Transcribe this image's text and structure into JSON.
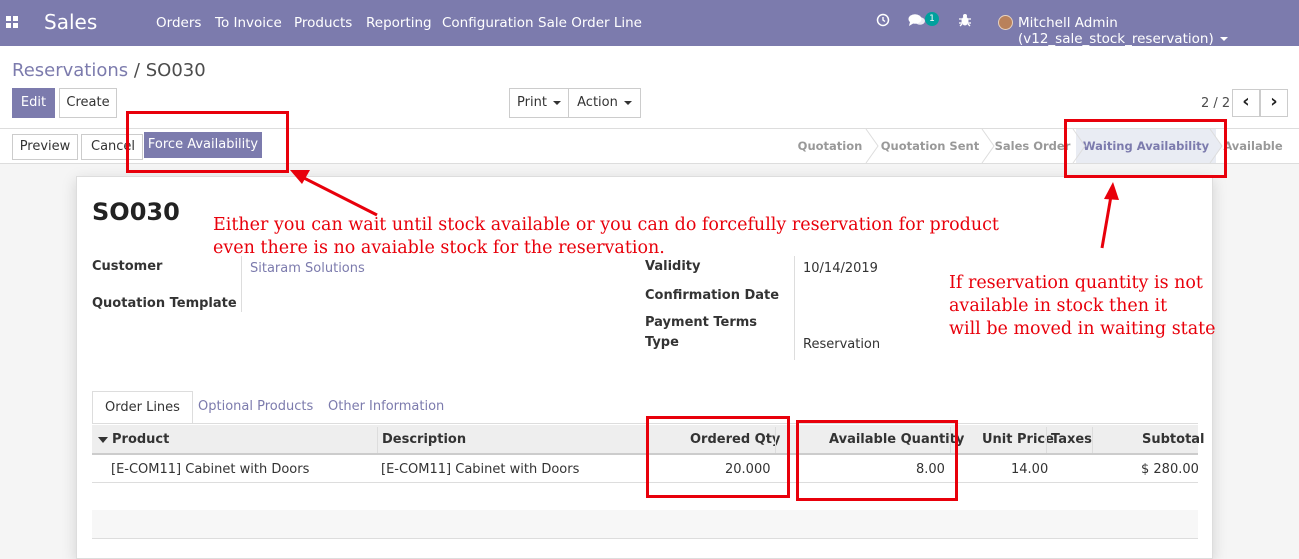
{
  "navbar": {
    "app_name": "Sales",
    "menu": [
      "Orders",
      "To Invoice",
      "Products",
      "Reporting",
      "Configuration",
      "Sale Order Line"
    ],
    "chat_badge": "1",
    "user": "Mitchell Admin (v12_sale_stock_reservation)"
  },
  "breadcrumb": {
    "parent": "Reservations",
    "separator": "/",
    "current": "SO030"
  },
  "buttons": {
    "edit": "Edit",
    "create": "Create",
    "print": "Print",
    "action": "Action",
    "preview": "Preview",
    "cancel": "Cancel",
    "force_availability": "Force Availability"
  },
  "pager": {
    "value": "2 / 2"
  },
  "statusbar": {
    "stages": [
      "Quotation",
      "Quotation Sent",
      "Sales Order",
      "Waiting Availability",
      "Available"
    ],
    "current": "Waiting Availability"
  },
  "form": {
    "name": "SO030",
    "customer_label": "Customer",
    "customer": "Sitaram Solutions",
    "template_label": "Quotation Template",
    "validity_label": "Validity",
    "validity": "10/14/2019",
    "confirmation_label": "Confirmation Date",
    "payment_label": "Payment Terms",
    "type_label": "Type",
    "type": "Reservation"
  },
  "tabs": [
    "Order Lines",
    "Optional Products",
    "Other Information"
  ],
  "table": {
    "columns": [
      "Product",
      "Description",
      "Ordered Qty",
      "Available Quantity",
      "Unit Price",
      "Taxes",
      "Subtotal"
    ],
    "rows": [
      {
        "product": "[E-COM11] Cabinet with Doors",
        "description": "[E-COM11] Cabinet with Doors",
        "ordered_qty": "20.000",
        "available_qty": "8.00",
        "unit_price": "14.00",
        "taxes": "",
        "subtotal": "$ 280.00"
      }
    ]
  },
  "annotations": {
    "note_force": "Either you can wait until stock available or you can do forcefully reservation for product\neven there is no avaiable stock for the reservation.",
    "note_waiting": "If reservation quantity is not\navailable in stock then it\nwill be moved in waiting state",
    "color": "#e8000b"
  },
  "colors": {
    "brand": "#7c7bad"
  }
}
